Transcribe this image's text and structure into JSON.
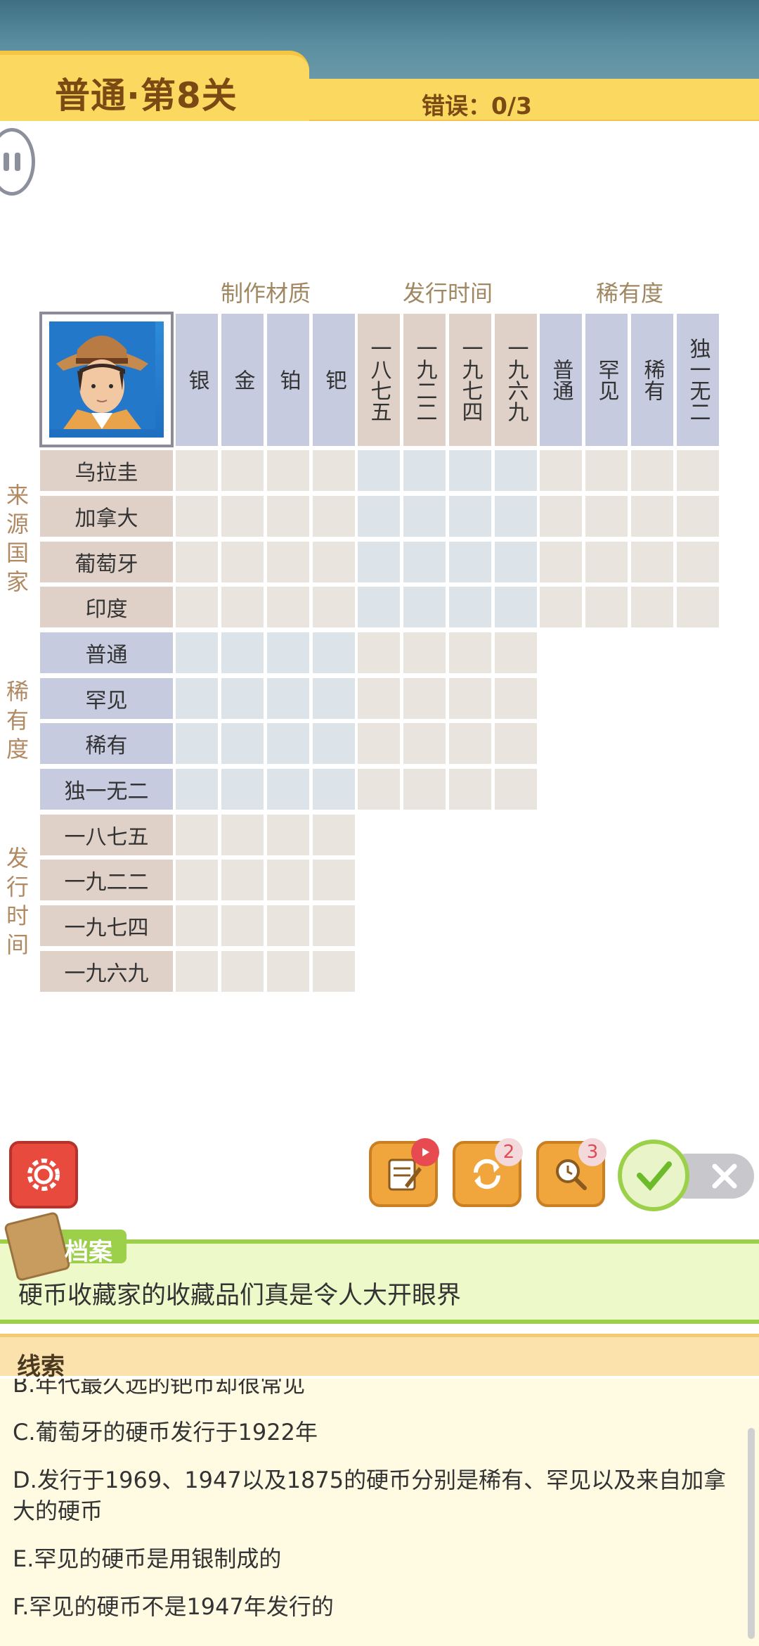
{
  "header": {
    "level_title": "普通·第8关",
    "error_label": "错误：0/3"
  },
  "grid": {
    "groups_top": [
      "制作材质",
      "发行时间",
      "稀有度"
    ],
    "columns": [
      "银",
      "金",
      "铂",
      "钯",
      "一八七五",
      "一九二二",
      "一九七四",
      "一九六九",
      "普通",
      "罕见",
      "稀有",
      "独一无二"
    ],
    "groups_left": [
      "来源国家",
      "稀有度",
      "发行时间"
    ],
    "rows": [
      "乌拉圭",
      "加拿大",
      "葡萄牙",
      "印度",
      "普通",
      "罕见",
      "稀有",
      "独一无二",
      "一八七五",
      "一九二二",
      "一九七四",
      "一九六九"
    ]
  },
  "toolbar": {
    "badge_refresh": "2",
    "badge_hint": "3"
  },
  "archive": {
    "label": "档案",
    "text": "硬币收藏家的收藏品们真是令人大开眼界"
  },
  "clues": {
    "title": "线索",
    "items": [
      "B.年代最久远的钯币却很常见",
      "C.葡萄牙的硬币发行于1922年",
      "D.发行于1969、1947以及1875的硬币分别是稀有、罕见以及来自加拿大的硬币",
      "E.罕见的硬币是用银制成的",
      "F.罕见的硬币不是1947年发行的"
    ]
  },
  "colors": {
    "material_header": "#c6cbe0",
    "time_header": "#dfd1c8",
    "rarity_header": "#c6cbe0",
    "cell_beige": "#e9e4de",
    "cell_blue": "#dce4ea",
    "banner": "#fbd860",
    "accent_green": "#9ccf4a"
  }
}
